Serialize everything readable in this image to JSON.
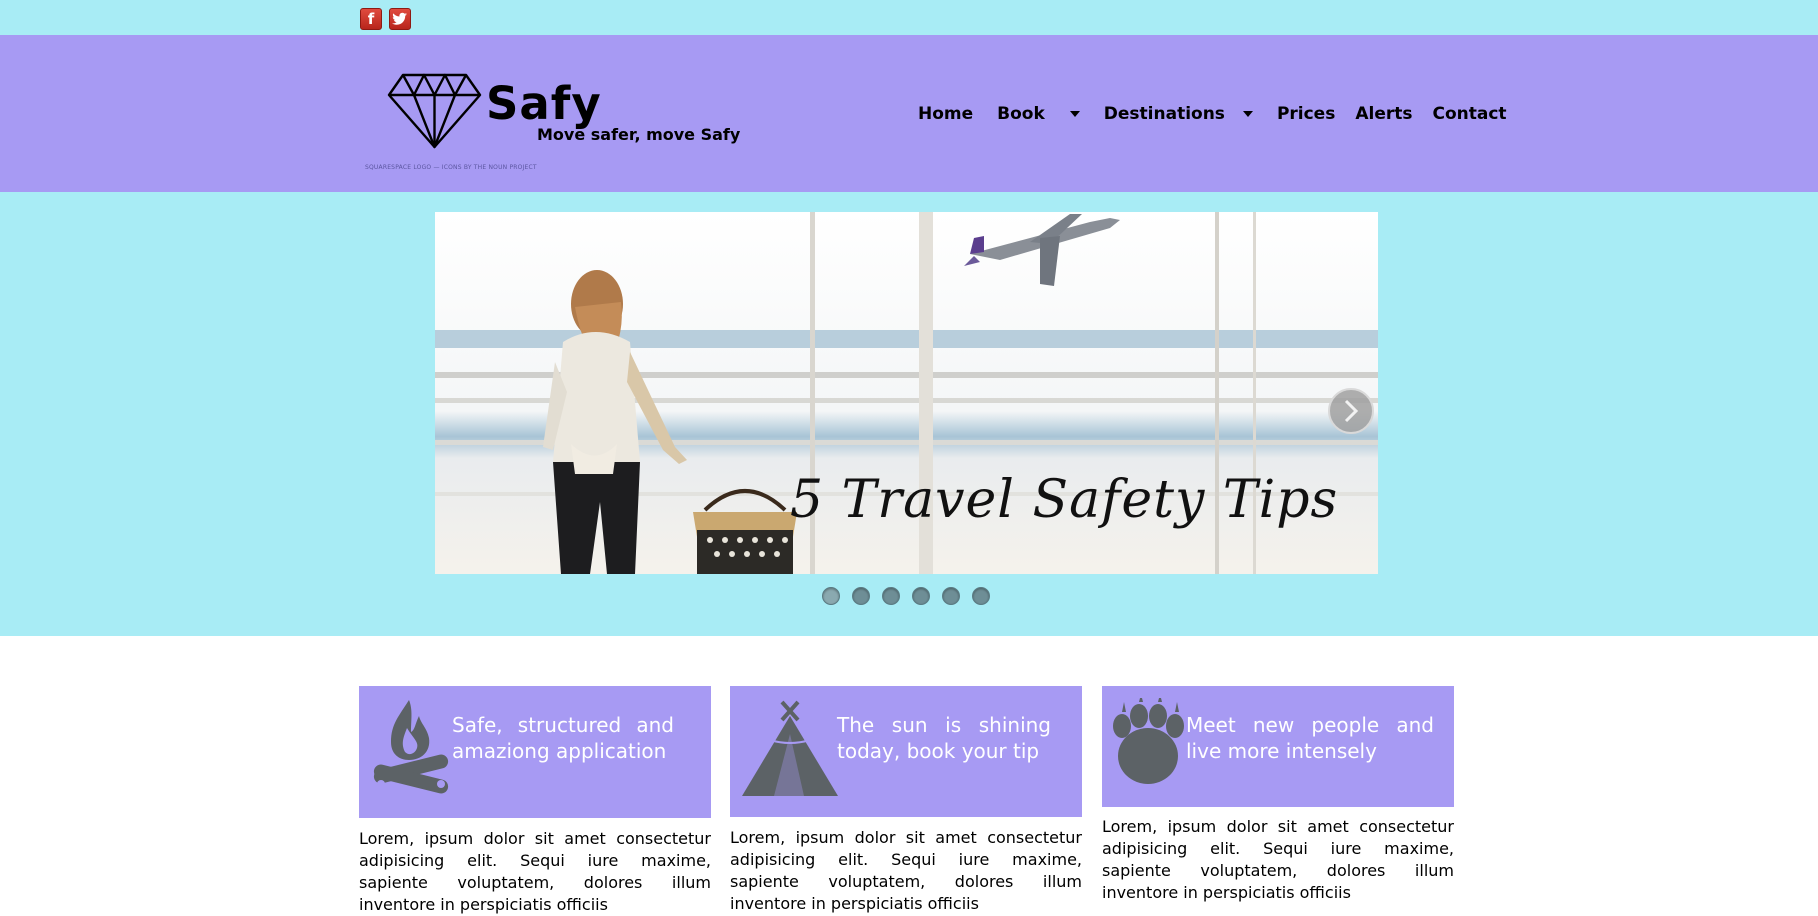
{
  "social": {
    "facebook_glyph": "f",
    "twitter_glyph": "t"
  },
  "header": {
    "brand": "Safy",
    "tagline": "Move safer, move Safy",
    "credit": "SQUARESPACE LOGO — ICONS BY THE NOUN PROJECT",
    "background_color": "#a79af3"
  },
  "nav": {
    "items": [
      {
        "label": "Home",
        "has_dropdown": false
      },
      {
        "label": "Book",
        "has_dropdown": true
      },
      {
        "label": "Destinations",
        "has_dropdown": true
      },
      {
        "label": "Prices",
        "has_dropdown": false
      },
      {
        "label": "Alerts",
        "has_dropdown": false
      },
      {
        "label": "Contact",
        "has_dropdown": false
      }
    ]
  },
  "hero": {
    "background_color": "#a8ecf5",
    "slide_caption": "5 Travel Safety Tips",
    "slide_count": 6,
    "active_slide": 1
  },
  "features": [
    {
      "icon": "campfire-icon",
      "title": "Safe, structured and amaziong application",
      "text": "Lorem, ipsum dolor sit amet consectetur adipisicing elit. Sequi iure maxime, sapiente voluptatem, dolores illum inventore in perspiciatis officiis"
    },
    {
      "icon": "tent-icon",
      "title": "The sun is shining today, book your tip",
      "text": "Lorem, ipsum dolor sit amet consectetur adipisicing elit. Sequi iure maxime, sapiente voluptatem, dolores illum inventore in perspiciatis officiis"
    },
    {
      "icon": "paw-icon",
      "title": "Meet new people and live more intensely",
      "text": "Lorem, ipsum dolor sit amet consectetur adipisicing elit. Sequi iure maxime, sapiente voluptatem, dolores illum inventore in perspiciatis officiis"
    }
  ]
}
